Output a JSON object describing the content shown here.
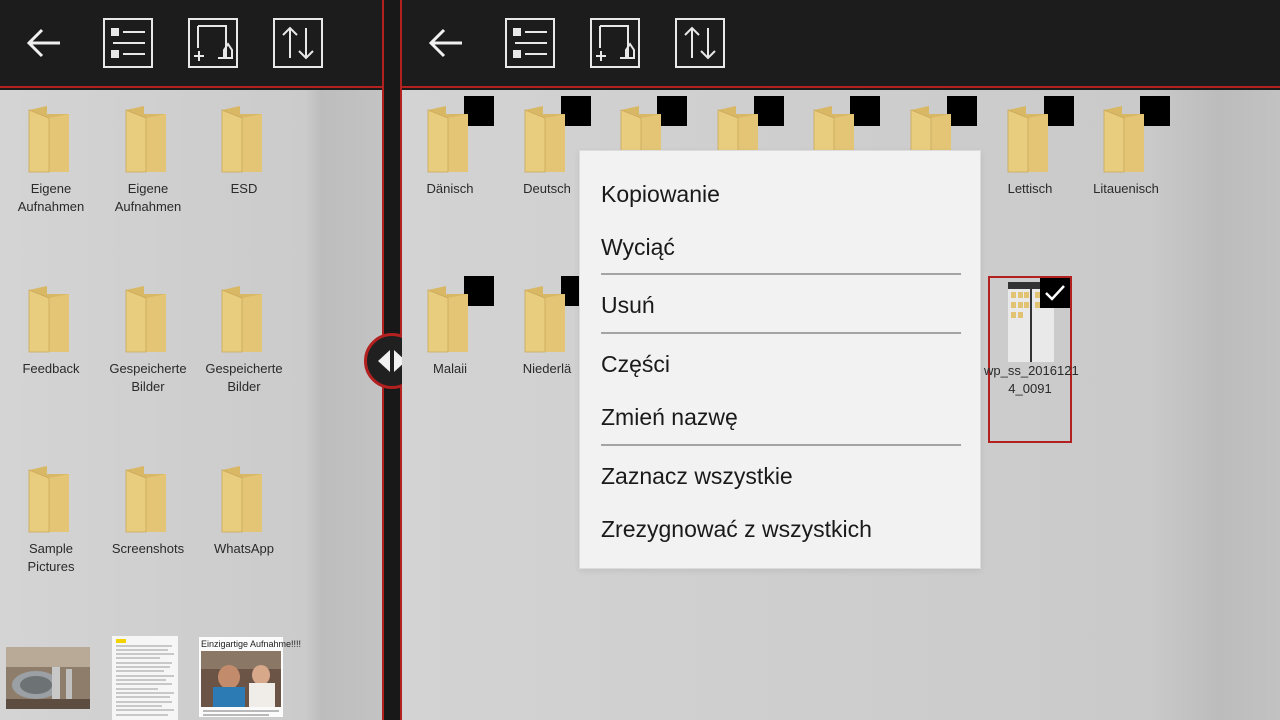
{
  "toolbar": {
    "icons": [
      "back-arrow-icon",
      "list-view-icon",
      "new-folder-icon",
      "sort-icon"
    ]
  },
  "left_pane": {
    "folders": [
      {
        "label": "Eigene\nAufnahmen"
      },
      {
        "label": "Eigene\nAufnahmen"
      },
      {
        "label": "ESD"
      },
      {
        "label": "Feedback"
      },
      {
        "label": "Gespeicherte\nBilder"
      },
      {
        "label": "Gespeicherte\nBilder"
      },
      {
        "label": "Sample\nPictures"
      },
      {
        "label": "Screenshots"
      },
      {
        "label": "WhatsApp"
      }
    ],
    "thumbnails": [
      {
        "name": "machine-photo"
      },
      {
        "name": "text-document"
      },
      {
        "name": "photo-post",
        "caption": "Einzigartige Aufnahme!!!!"
      }
    ]
  },
  "right_pane": {
    "folders": [
      {
        "label": "Dänisch"
      },
      {
        "label": "Deutsch"
      },
      {
        "label": ""
      },
      {
        "label": ""
      },
      {
        "label": ""
      },
      {
        "label": ""
      },
      {
        "label": "Lettisch"
      },
      {
        "label": "Litauenisch"
      },
      {
        "label": "Malaii"
      },
      {
        "label": "Niederlä"
      }
    ],
    "selected_file": {
      "label": "wp_ss_2016121\n4_0091",
      "selected": true
    }
  },
  "context_menu": {
    "items": [
      "Kopiowanie",
      "Wyciąć",
      "Usuń",
      "Części",
      "Zmień nazwę",
      "Zaznacz wszystkie",
      "Zrezygnować z wszystkich"
    ]
  },
  "colors": {
    "accent": "#b32020",
    "toolbar": "#1c1c1c",
    "folder": "#e8c97a",
    "menu_bg": "#f2f2f2"
  }
}
